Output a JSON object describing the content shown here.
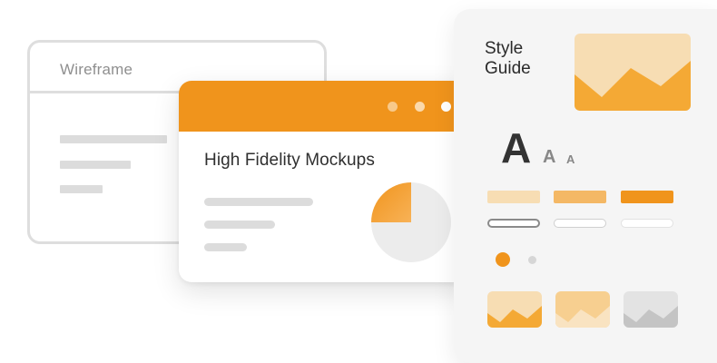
{
  "wireframe": {
    "title": "Wireframe"
  },
  "mockup": {
    "title": "High Fidelity Mockups",
    "header_color": "#f0941c",
    "pie_fraction": 0.25
  },
  "style_guide": {
    "title": "Style Guide",
    "type_samples": [
      "A",
      "A",
      "A"
    ],
    "swatch_colors": [
      "#f7ddb3",
      "#f4b865",
      "#f0941c"
    ],
    "accent": "#f0941c"
  }
}
